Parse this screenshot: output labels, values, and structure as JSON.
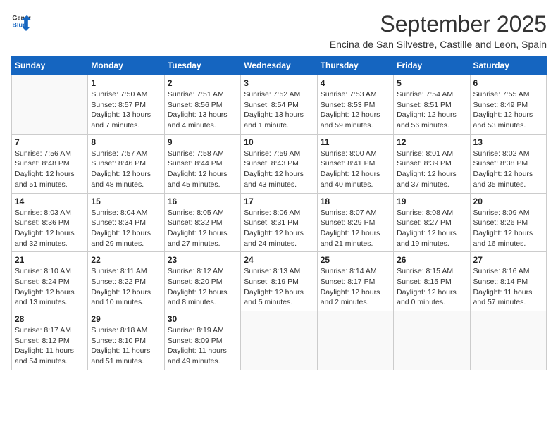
{
  "header": {
    "logo_general": "General",
    "logo_blue": "Blue",
    "month_title": "September 2025",
    "subtitle": "Encina de San Silvestre, Castille and Leon, Spain"
  },
  "days_of_week": [
    "Sunday",
    "Monday",
    "Tuesday",
    "Wednesday",
    "Thursday",
    "Friday",
    "Saturday"
  ],
  "weeks": [
    [
      {
        "day": "",
        "info": ""
      },
      {
        "day": "1",
        "info": "Sunrise: 7:50 AM\nSunset: 8:57 PM\nDaylight: 13 hours\nand 7 minutes."
      },
      {
        "day": "2",
        "info": "Sunrise: 7:51 AM\nSunset: 8:56 PM\nDaylight: 13 hours\nand 4 minutes."
      },
      {
        "day": "3",
        "info": "Sunrise: 7:52 AM\nSunset: 8:54 PM\nDaylight: 13 hours\nand 1 minute."
      },
      {
        "day": "4",
        "info": "Sunrise: 7:53 AM\nSunset: 8:53 PM\nDaylight: 12 hours\nand 59 minutes."
      },
      {
        "day": "5",
        "info": "Sunrise: 7:54 AM\nSunset: 8:51 PM\nDaylight: 12 hours\nand 56 minutes."
      },
      {
        "day": "6",
        "info": "Sunrise: 7:55 AM\nSunset: 8:49 PM\nDaylight: 12 hours\nand 53 minutes."
      }
    ],
    [
      {
        "day": "7",
        "info": "Sunrise: 7:56 AM\nSunset: 8:48 PM\nDaylight: 12 hours\nand 51 minutes."
      },
      {
        "day": "8",
        "info": "Sunrise: 7:57 AM\nSunset: 8:46 PM\nDaylight: 12 hours\nand 48 minutes."
      },
      {
        "day": "9",
        "info": "Sunrise: 7:58 AM\nSunset: 8:44 PM\nDaylight: 12 hours\nand 45 minutes."
      },
      {
        "day": "10",
        "info": "Sunrise: 7:59 AM\nSunset: 8:43 PM\nDaylight: 12 hours\nand 43 minutes."
      },
      {
        "day": "11",
        "info": "Sunrise: 8:00 AM\nSunset: 8:41 PM\nDaylight: 12 hours\nand 40 minutes."
      },
      {
        "day": "12",
        "info": "Sunrise: 8:01 AM\nSunset: 8:39 PM\nDaylight: 12 hours\nand 37 minutes."
      },
      {
        "day": "13",
        "info": "Sunrise: 8:02 AM\nSunset: 8:38 PM\nDaylight: 12 hours\nand 35 minutes."
      }
    ],
    [
      {
        "day": "14",
        "info": "Sunrise: 8:03 AM\nSunset: 8:36 PM\nDaylight: 12 hours\nand 32 minutes."
      },
      {
        "day": "15",
        "info": "Sunrise: 8:04 AM\nSunset: 8:34 PM\nDaylight: 12 hours\nand 29 minutes."
      },
      {
        "day": "16",
        "info": "Sunrise: 8:05 AM\nSunset: 8:32 PM\nDaylight: 12 hours\nand 27 minutes."
      },
      {
        "day": "17",
        "info": "Sunrise: 8:06 AM\nSunset: 8:31 PM\nDaylight: 12 hours\nand 24 minutes."
      },
      {
        "day": "18",
        "info": "Sunrise: 8:07 AM\nSunset: 8:29 PM\nDaylight: 12 hours\nand 21 minutes."
      },
      {
        "day": "19",
        "info": "Sunrise: 8:08 AM\nSunset: 8:27 PM\nDaylight: 12 hours\nand 19 minutes."
      },
      {
        "day": "20",
        "info": "Sunrise: 8:09 AM\nSunset: 8:26 PM\nDaylight: 12 hours\nand 16 minutes."
      }
    ],
    [
      {
        "day": "21",
        "info": "Sunrise: 8:10 AM\nSunset: 8:24 PM\nDaylight: 12 hours\nand 13 minutes."
      },
      {
        "day": "22",
        "info": "Sunrise: 8:11 AM\nSunset: 8:22 PM\nDaylight: 12 hours\nand 10 minutes."
      },
      {
        "day": "23",
        "info": "Sunrise: 8:12 AM\nSunset: 8:20 PM\nDaylight: 12 hours\nand 8 minutes."
      },
      {
        "day": "24",
        "info": "Sunrise: 8:13 AM\nSunset: 8:19 PM\nDaylight: 12 hours\nand 5 minutes."
      },
      {
        "day": "25",
        "info": "Sunrise: 8:14 AM\nSunset: 8:17 PM\nDaylight: 12 hours\nand 2 minutes."
      },
      {
        "day": "26",
        "info": "Sunrise: 8:15 AM\nSunset: 8:15 PM\nDaylight: 12 hours\nand 0 minutes."
      },
      {
        "day": "27",
        "info": "Sunrise: 8:16 AM\nSunset: 8:14 PM\nDaylight: 11 hours\nand 57 minutes."
      }
    ],
    [
      {
        "day": "28",
        "info": "Sunrise: 8:17 AM\nSunset: 8:12 PM\nDaylight: 11 hours\nand 54 minutes."
      },
      {
        "day": "29",
        "info": "Sunrise: 8:18 AM\nSunset: 8:10 PM\nDaylight: 11 hours\nand 51 minutes."
      },
      {
        "day": "30",
        "info": "Sunrise: 8:19 AM\nSunset: 8:09 PM\nDaylight: 11 hours\nand 49 minutes."
      },
      {
        "day": "",
        "info": ""
      },
      {
        "day": "",
        "info": ""
      },
      {
        "day": "",
        "info": ""
      },
      {
        "day": "",
        "info": ""
      }
    ]
  ]
}
